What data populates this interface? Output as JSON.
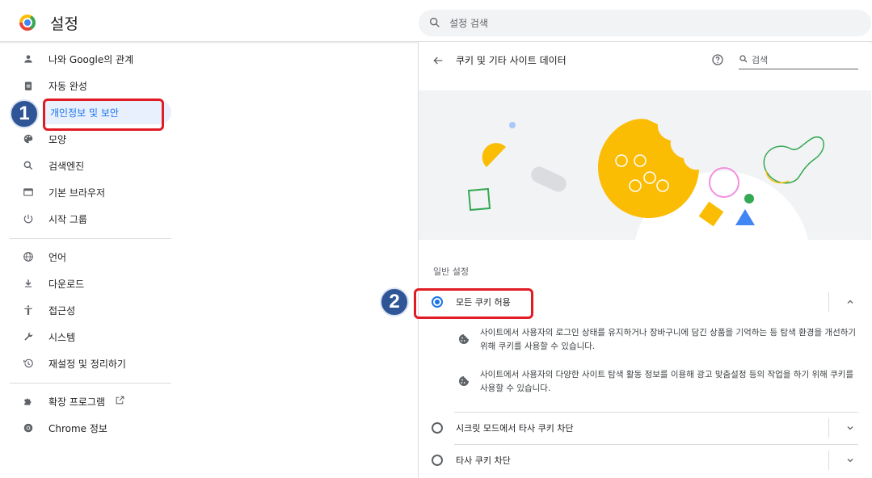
{
  "header": {
    "title": "설정",
    "search_placeholder": "설정 검색"
  },
  "sidebar": {
    "items": [
      {
        "label": "나와 Google의 관계",
        "icon": "person-icon"
      },
      {
        "label": "자동 완성",
        "icon": "clipboard-icon"
      },
      {
        "label": "개인정보 및 보안",
        "icon": "shield-icon",
        "active": true
      },
      {
        "label": "모양",
        "icon": "palette-icon"
      },
      {
        "label": "검색엔진",
        "icon": "search-icon"
      },
      {
        "label": "기본 브라우저",
        "icon": "browser-icon"
      },
      {
        "label": "시작 그룹",
        "icon": "power-icon"
      },
      {
        "label": "언어",
        "icon": "globe-icon"
      },
      {
        "label": "다운로드",
        "icon": "download-icon"
      },
      {
        "label": "접근성",
        "icon": "accessibility-icon"
      },
      {
        "label": "시스템",
        "icon": "wrench-icon"
      },
      {
        "label": "재설정 및 정리하기",
        "icon": "history-icon"
      },
      {
        "label": "확장 프로그램",
        "icon": "puzzle-icon"
      },
      {
        "label": "Chrome 정보",
        "icon": "chrome-icon"
      }
    ]
  },
  "main": {
    "title": "쿠키 및 기타 사이트 데이터",
    "search_placeholder": "검색",
    "section_label": "일반 설정",
    "options": [
      {
        "label": "모든 쿠키 허용",
        "checked": true
      },
      {
        "label": "시크릿 모드에서 타사 쿠키 차단",
        "checked": false
      },
      {
        "label": "타사 쿠키 차단",
        "checked": false
      }
    ],
    "descriptions": [
      "사이트에서 사용자의 로그인 상태를 유지하거나 장바구니에 담긴 상품을 기억하는 등 탐색 환경을 개선하기 위해 쿠키를 사용할 수 있습니다.",
      "사이트에서 사용자의 다양한 사이트 탐색 활동 정보를 이용해 광고 맞춤설정 등의 작업을 하기 위해 쿠키를 사용할 수 있습니다."
    ]
  },
  "callouts": {
    "one": "1",
    "two": "2"
  },
  "colors": {
    "accent": "#1a73e8",
    "callout_fill": "#2f5597",
    "callout_border": "#e01b24"
  }
}
